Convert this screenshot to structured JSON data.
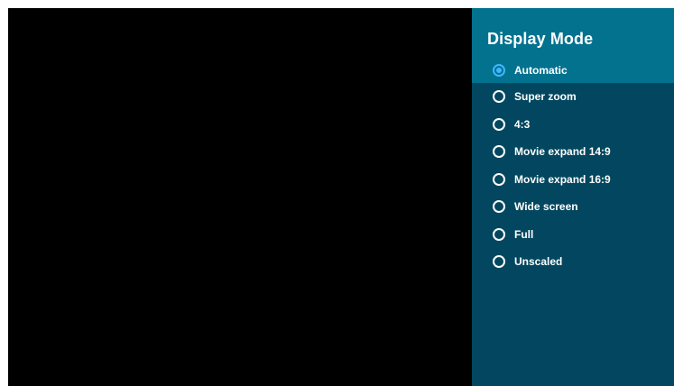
{
  "display_mode_panel": {
    "title": "Display Mode",
    "selected_index": 0,
    "options": [
      {
        "label": "Automatic",
        "selected": true
      },
      {
        "label": "Super zoom",
        "selected": false
      },
      {
        "label": "4:3",
        "selected": false
      },
      {
        "label": "Movie expand 14:9",
        "selected": false
      },
      {
        "label": "Movie expand 16:9",
        "selected": false
      },
      {
        "label": "Wide screen",
        "selected": false
      },
      {
        "label": "Full",
        "selected": false
      },
      {
        "label": "Unscaled",
        "selected": false
      }
    ]
  },
  "colors": {
    "screen_background": "#000000",
    "panel_background": "#02475f",
    "header_background": "#02728f",
    "selected_row_background": "#02728f",
    "selected_radio": "#3fb6ff",
    "text": "#ffffff"
  },
  "icons": {
    "selected_option": "radio-checked-icon",
    "unselected_option": "radio-unchecked-icon"
  }
}
